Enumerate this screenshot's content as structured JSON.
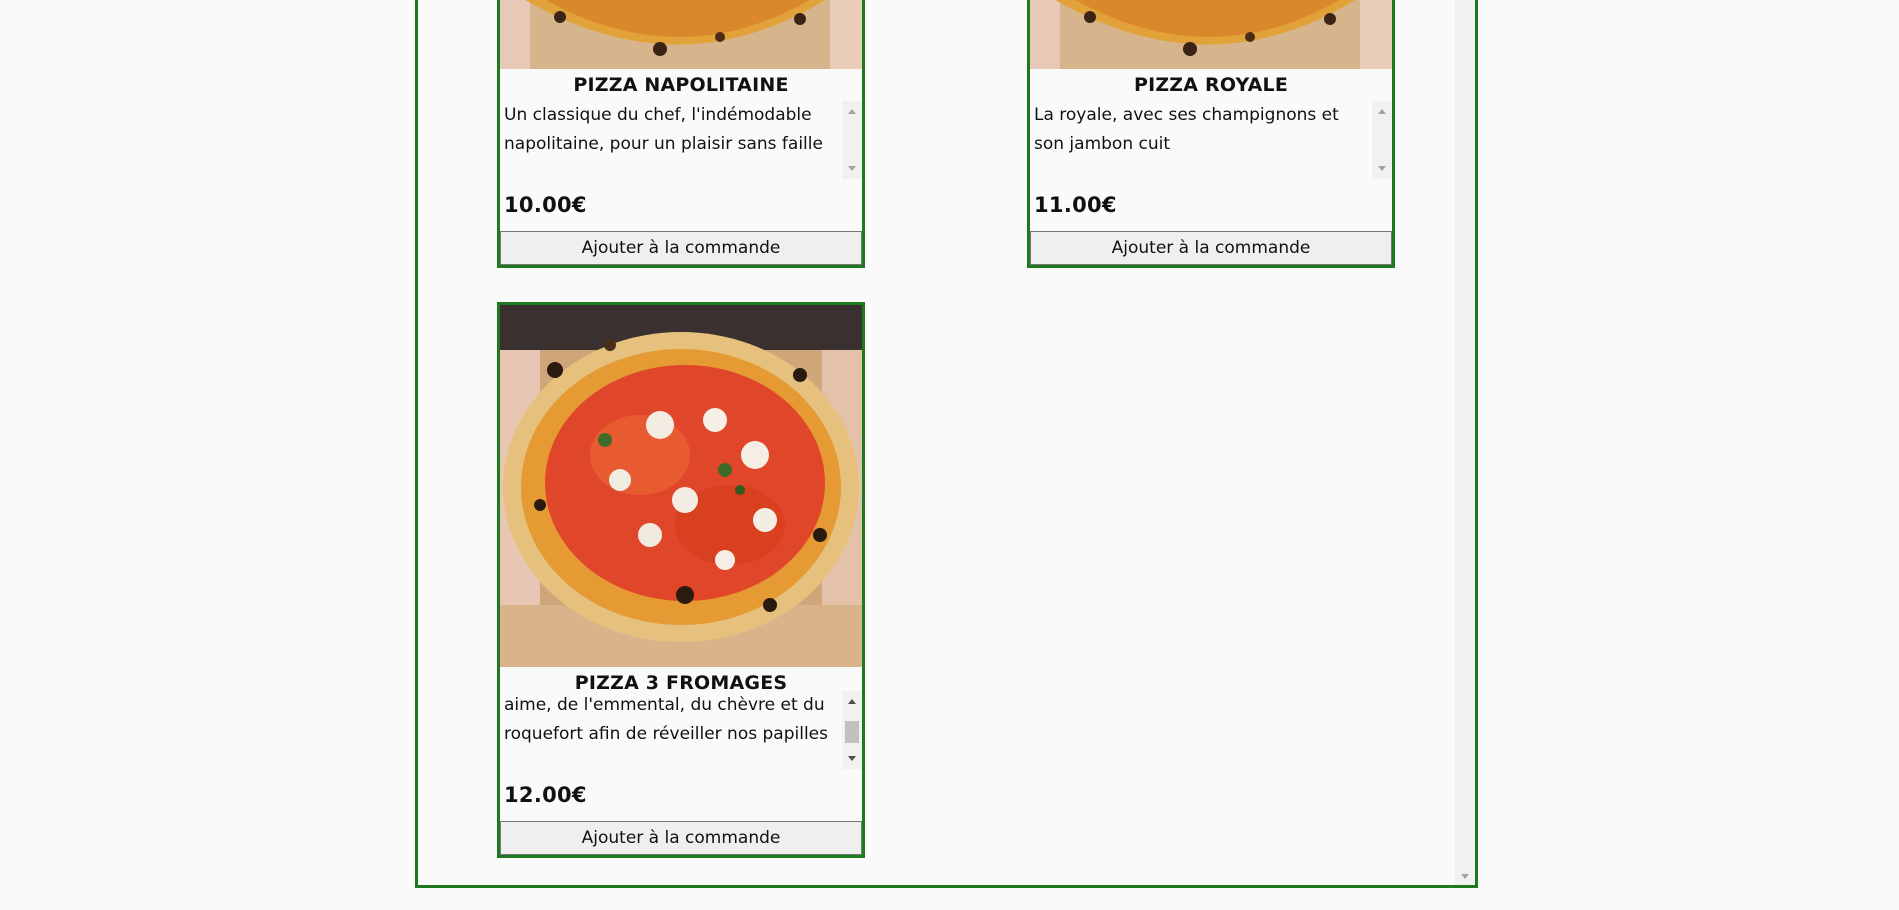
{
  "pizzas": [
    {
      "name": "PIZZA NAPOLITAINE",
      "description": "Un classique du chef, l'indémodable napolitaine, pour un plaisir sans faille",
      "price": "10.00€",
      "button": "Ajouter à la commande"
    },
    {
      "name": "PIZZA ROYALE",
      "description": "La royale, avec ses champignons et son jambon cuit",
      "price": "11.00€",
      "button": "Ajouter à la commande"
    },
    {
      "name": "PIZZA 3 FROMAGES",
      "description": "aime, de l'emmental, du chèvre et du roquefort afin de réveiller nos papilles",
      "price": "12.00€",
      "button": "Ajouter à la commande"
    }
  ],
  "colors": {
    "border": "#1f7a1f",
    "background": "#fafafa",
    "button_bg": "#efefef"
  },
  "icons": [
    "scroll-up-arrow-icon",
    "scroll-down-arrow-icon"
  ]
}
